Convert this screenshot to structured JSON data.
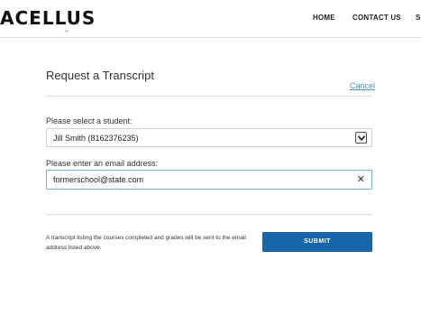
{
  "header": {
    "logo": "ACELLUS",
    "logo_mark": "™",
    "nav": {
      "home": "HOME",
      "contact": "CONTACT US",
      "partial": "S"
    }
  },
  "form": {
    "title": "Request a Transcript",
    "cancel_label": "Cancel",
    "student_label": "Please select a student:",
    "student_selected": "Jill Smith (8162376235)",
    "email_label": "Please enter an email address:",
    "email_value": "formerschool@state.com",
    "clear_glyph": "✕",
    "note": "A transcript listing the courses completed and grades will be sent to the email address listed above.",
    "submit_label": "SUBMIT"
  },
  "colors": {
    "submit_bg": "#1565a8",
    "link": "#4a90c2",
    "input_focus_border": "#66b3e0"
  },
  "icons": {
    "select_arrow": "chevron-down-icon",
    "clear": "close-icon"
  }
}
